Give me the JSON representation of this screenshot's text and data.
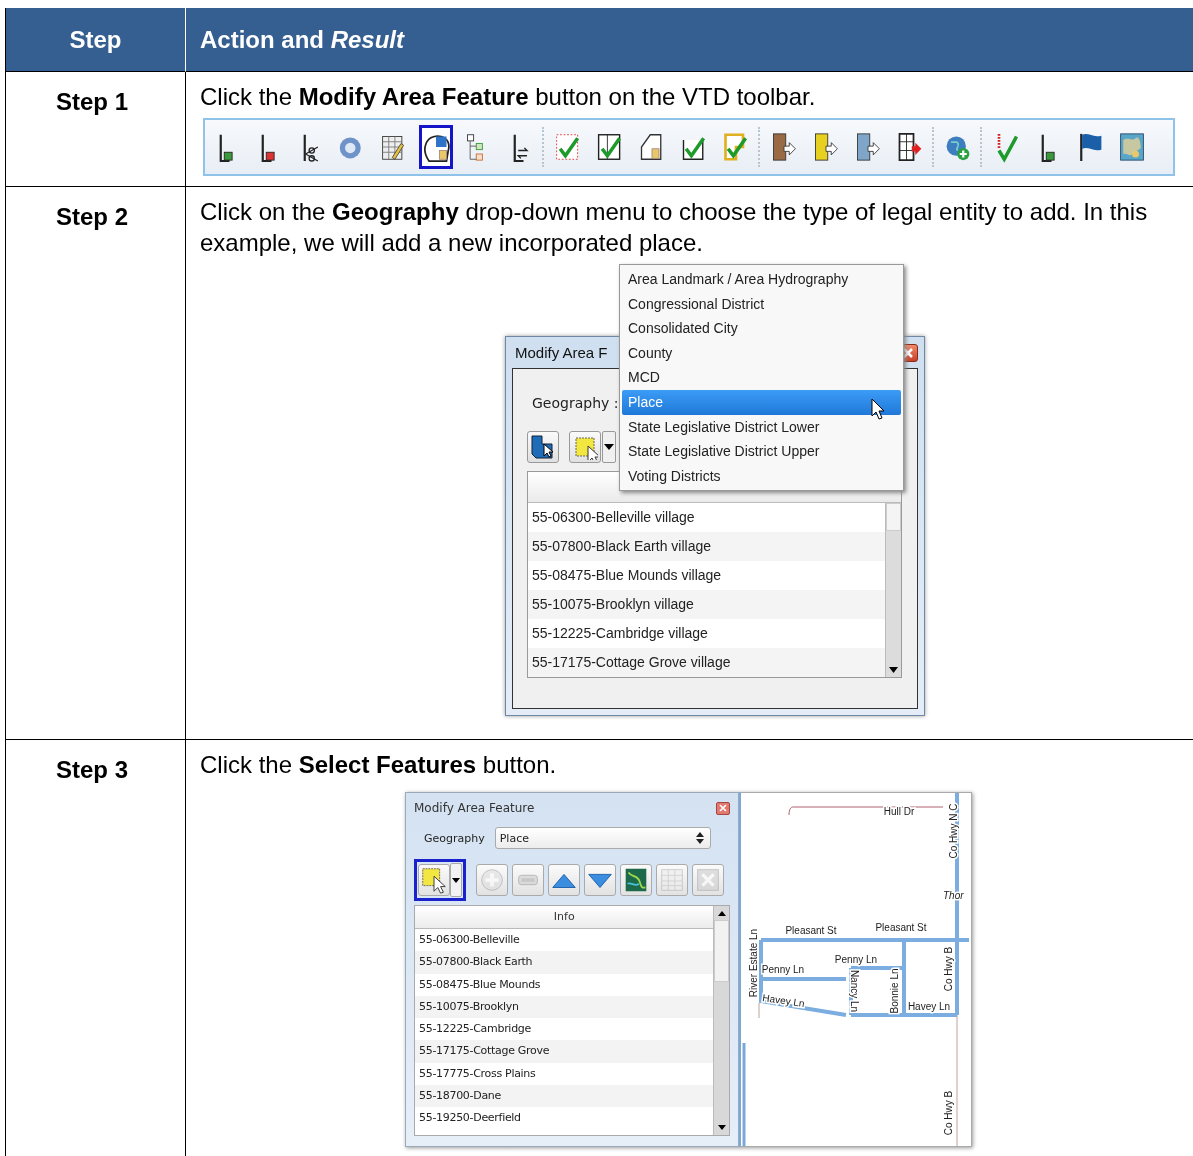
{
  "table": {
    "columns": [
      "Step",
      "Action and *Result*"
    ],
    "rows": [
      {
        "step": "Step 1",
        "instruction": "Click the **Modify Area Feature** button on the VTD toolbar.",
        "figure": {
          "kind": "toolbar",
          "groups": [
            [
              {
                "kind": "pin-plus",
                "selected": false
              },
              {
                "kind": "pin-delete",
                "selected": false
              },
              {
                "kind": "scissors",
                "selected": false
              },
              {
                "kind": "circle",
                "selected": false
              },
              {
                "kind": "table-edit",
                "selected": false
              },
              {
                "kind": "head",
                "selected": true
              },
              {
                "kind": "hierarchy",
                "selected": false
              },
              {
                "kind": "pin-arrows",
                "selected": false
              }
            ],
            [
              {
                "kind": "check-dotted",
                "selected": false
              },
              {
                "kind": "check-split",
                "selected": false
              },
              {
                "kind": "shape-edit",
                "selected": false
              },
              {
                "kind": "check",
                "selected": false
              },
              {
                "kind": "check-yellow",
                "selected": false
              }
            ],
            [
              {
                "kind": "door-brown",
                "selected": false
              },
              {
                "kind": "door-yellow",
                "selected": false
              },
              {
                "kind": "door-blue",
                "selected": false
              },
              {
                "kind": "door-red",
                "selected": false
              }
            ],
            [
              {
                "kind": "globe-plus",
                "selected": false
              }
            ],
            [
              {
                "kind": "year-check",
                "selected": false
              },
              {
                "kind": "pin-plus",
                "selected": false
              },
              {
                "kind": "flag",
                "selected": false
              },
              {
                "kind": "map",
                "selected": false
              }
            ]
          ]
        }
      },
      {
        "step": "Step 2",
        "instruction": "Click on the **Geography** drop-down menu to choose the type of legal entity to add. In this example, we will add a new incorporated place.",
        "figure": {
          "kind": "dropdown-dialog",
          "dialog_title": "Modify Area F",
          "geography_label": "Geography :",
          "list_rows": [
            "55-06300-Belleville village",
            "55-07800-Black Earth village",
            "55-08475-Blue Mounds village",
            "55-10075-Brooklyn village",
            "55-12225-Cambridge village",
            "55-17175-Cottage Grove village"
          ],
          "menu": [
            {
              "label": "Area Landmark / Area Hydrography",
              "selected": false
            },
            {
              "label": "Congressional District",
              "selected": false
            },
            {
              "label": "Consolidated City",
              "selected": false
            },
            {
              "label": "County",
              "selected": false
            },
            {
              "label": "MCD",
              "selected": false
            },
            {
              "label": "Place",
              "selected": true
            },
            {
              "label": "State Legislative District Lower",
              "selected": false
            },
            {
              "label": "State Legislative District Upper",
              "selected": false
            },
            {
              "label": "Voting Districts",
              "selected": false
            }
          ]
        }
      },
      {
        "step": "Step 3",
        "instruction": "Click the **Select Features** button.",
        "figure": {
          "kind": "dialog-map",
          "dialog_title": "Modify Area Feature",
          "geography_label": "Geography",
          "geography_value": "Place",
          "tools": [
            {
              "kind": "select",
              "selected": true,
              "disabled": false
            },
            {
              "kind": "plus",
              "selected": false,
              "disabled": true
            },
            {
              "kind": "minus",
              "selected": false,
              "disabled": true
            },
            {
              "kind": "up",
              "selected": false,
              "disabled": false
            },
            {
              "kind": "down",
              "selected": false,
              "disabled": false
            },
            {
              "kind": "map",
              "selected": false,
              "disabled": false
            },
            {
              "kind": "table",
              "selected": false,
              "disabled": true
            },
            {
              "kind": "delete",
              "selected": false,
              "disabled": true
            }
          ],
          "list_header": "Info",
          "list_rows": [
            "55-06300-Belleville",
            "55-07800-Black Earth",
            "55-08475-Blue Mounds",
            "55-10075-Brooklyn",
            "55-12225-Cambridge",
            "55-17175-Cottage Grove",
            "55-17775-Cross Plains",
            "55-18700-Dane",
            "55-19250-Deerfield"
          ],
          "map_labels": [
            "Hull Dr",
            "Co Hwy N C",
            "Thor",
            "Pleasant St",
            "Pleasant St",
            "Penny Ln",
            "Penny Ln",
            "Havey Ln",
            "Havey Ln",
            "River Estate Ln",
            "Nancy Ln",
            "Bonnie Ln",
            "Co Hwy B",
            "Co Hwy B"
          ]
        }
      }
    ]
  }
}
